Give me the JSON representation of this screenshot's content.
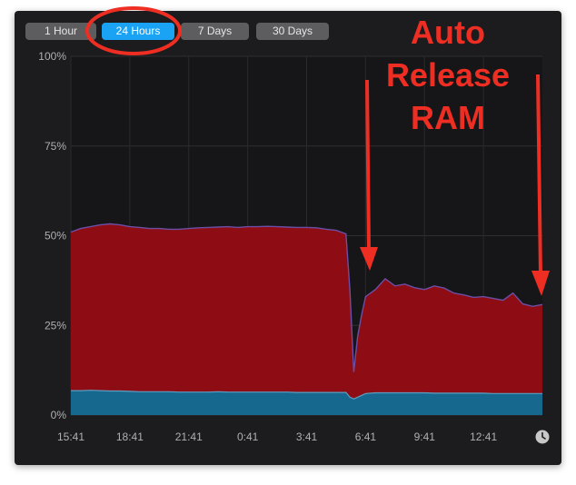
{
  "toolbar": {
    "ranges": [
      {
        "label": "1 Hour",
        "active": false
      },
      {
        "label": "24 Hours",
        "active": true
      },
      {
        "label": "7 Days",
        "active": false
      },
      {
        "label": "30 Days",
        "active": false
      }
    ]
  },
  "colors": {
    "panel": "#1c1c1e",
    "active_tab": "#1aa3f5",
    "series_upper": "#8e0c13",
    "series_lower": "#17688e",
    "annotation": "#ee2e23"
  },
  "chart_data": {
    "type": "area",
    "stacked": true,
    "x_tick_labels": [
      "15:41",
      "18:41",
      "21:41",
      "0:41",
      "3:41",
      "6:41",
      "9:41",
      "12:41"
    ],
    "y_tick_labels": [
      "100%",
      "75%",
      "50%",
      "25%",
      "0%"
    ],
    "ylim": [
      0,
      100
    ],
    "x": [
      0,
      0.5,
      1,
      1.5,
      2,
      2.5,
      3,
      3.5,
      4,
      4.5,
      5,
      5.5,
      6,
      6.5,
      7,
      7.5,
      8,
      8.5,
      9,
      9.5,
      10,
      10.5,
      11,
      11.5,
      12,
      12.5,
      13,
      13.5,
      14,
      14.2,
      14.4,
      14.6,
      14.8,
      15,
      15.5,
      16,
      16.5,
      17,
      17.5,
      18,
      18.5,
      19,
      19.5,
      20,
      20.5,
      21,
      21.5,
      22,
      22.5,
      23,
      23.5,
      24
    ],
    "series": [
      {
        "values": [
          6.8,
          6.8,
          6.9,
          6.8,
          6.7,
          6.7,
          6.6,
          6.5,
          6.5,
          6.5,
          6.5,
          6.4,
          6.4,
          6.4,
          6.4,
          6.5,
          6.4,
          6.4,
          6.4,
          6.4,
          6.4,
          6.4,
          6.4,
          6.3,
          6.3,
          6.3,
          6.3,
          6.3,
          6.3,
          5.0,
          4.5,
          5.0,
          5.5,
          6.0,
          6.2,
          6.2,
          6.2,
          6.2,
          6.2,
          6.2,
          6.1,
          6.1,
          6.1,
          6.1,
          6.1,
          6.1,
          6.0,
          6.0,
          6.0,
          6.0,
          6.0,
          6.0
        ]
      },
      {
        "values": [
          51,
          52,
          52.5,
          53,
          53.3,
          53,
          52.5,
          52.3,
          52,
          52,
          51.8,
          51.8,
          52,
          52.2,
          52.3,
          52.4,
          52.5,
          52.3,
          52.5,
          52.5,
          52.6,
          52.5,
          52.4,
          52.3,
          52.3,
          52.2,
          51.8,
          51.5,
          50.5,
          35,
          12,
          22,
          28,
          33,
          35,
          38,
          36,
          36.5,
          35.5,
          35,
          36,
          35.4,
          34,
          33.5,
          32.8,
          33,
          32.5,
          32,
          34,
          31,
          30.3,
          30.8
        ]
      }
    ]
  },
  "annotation": {
    "text": "Auto\nRelease\nRAM"
  }
}
